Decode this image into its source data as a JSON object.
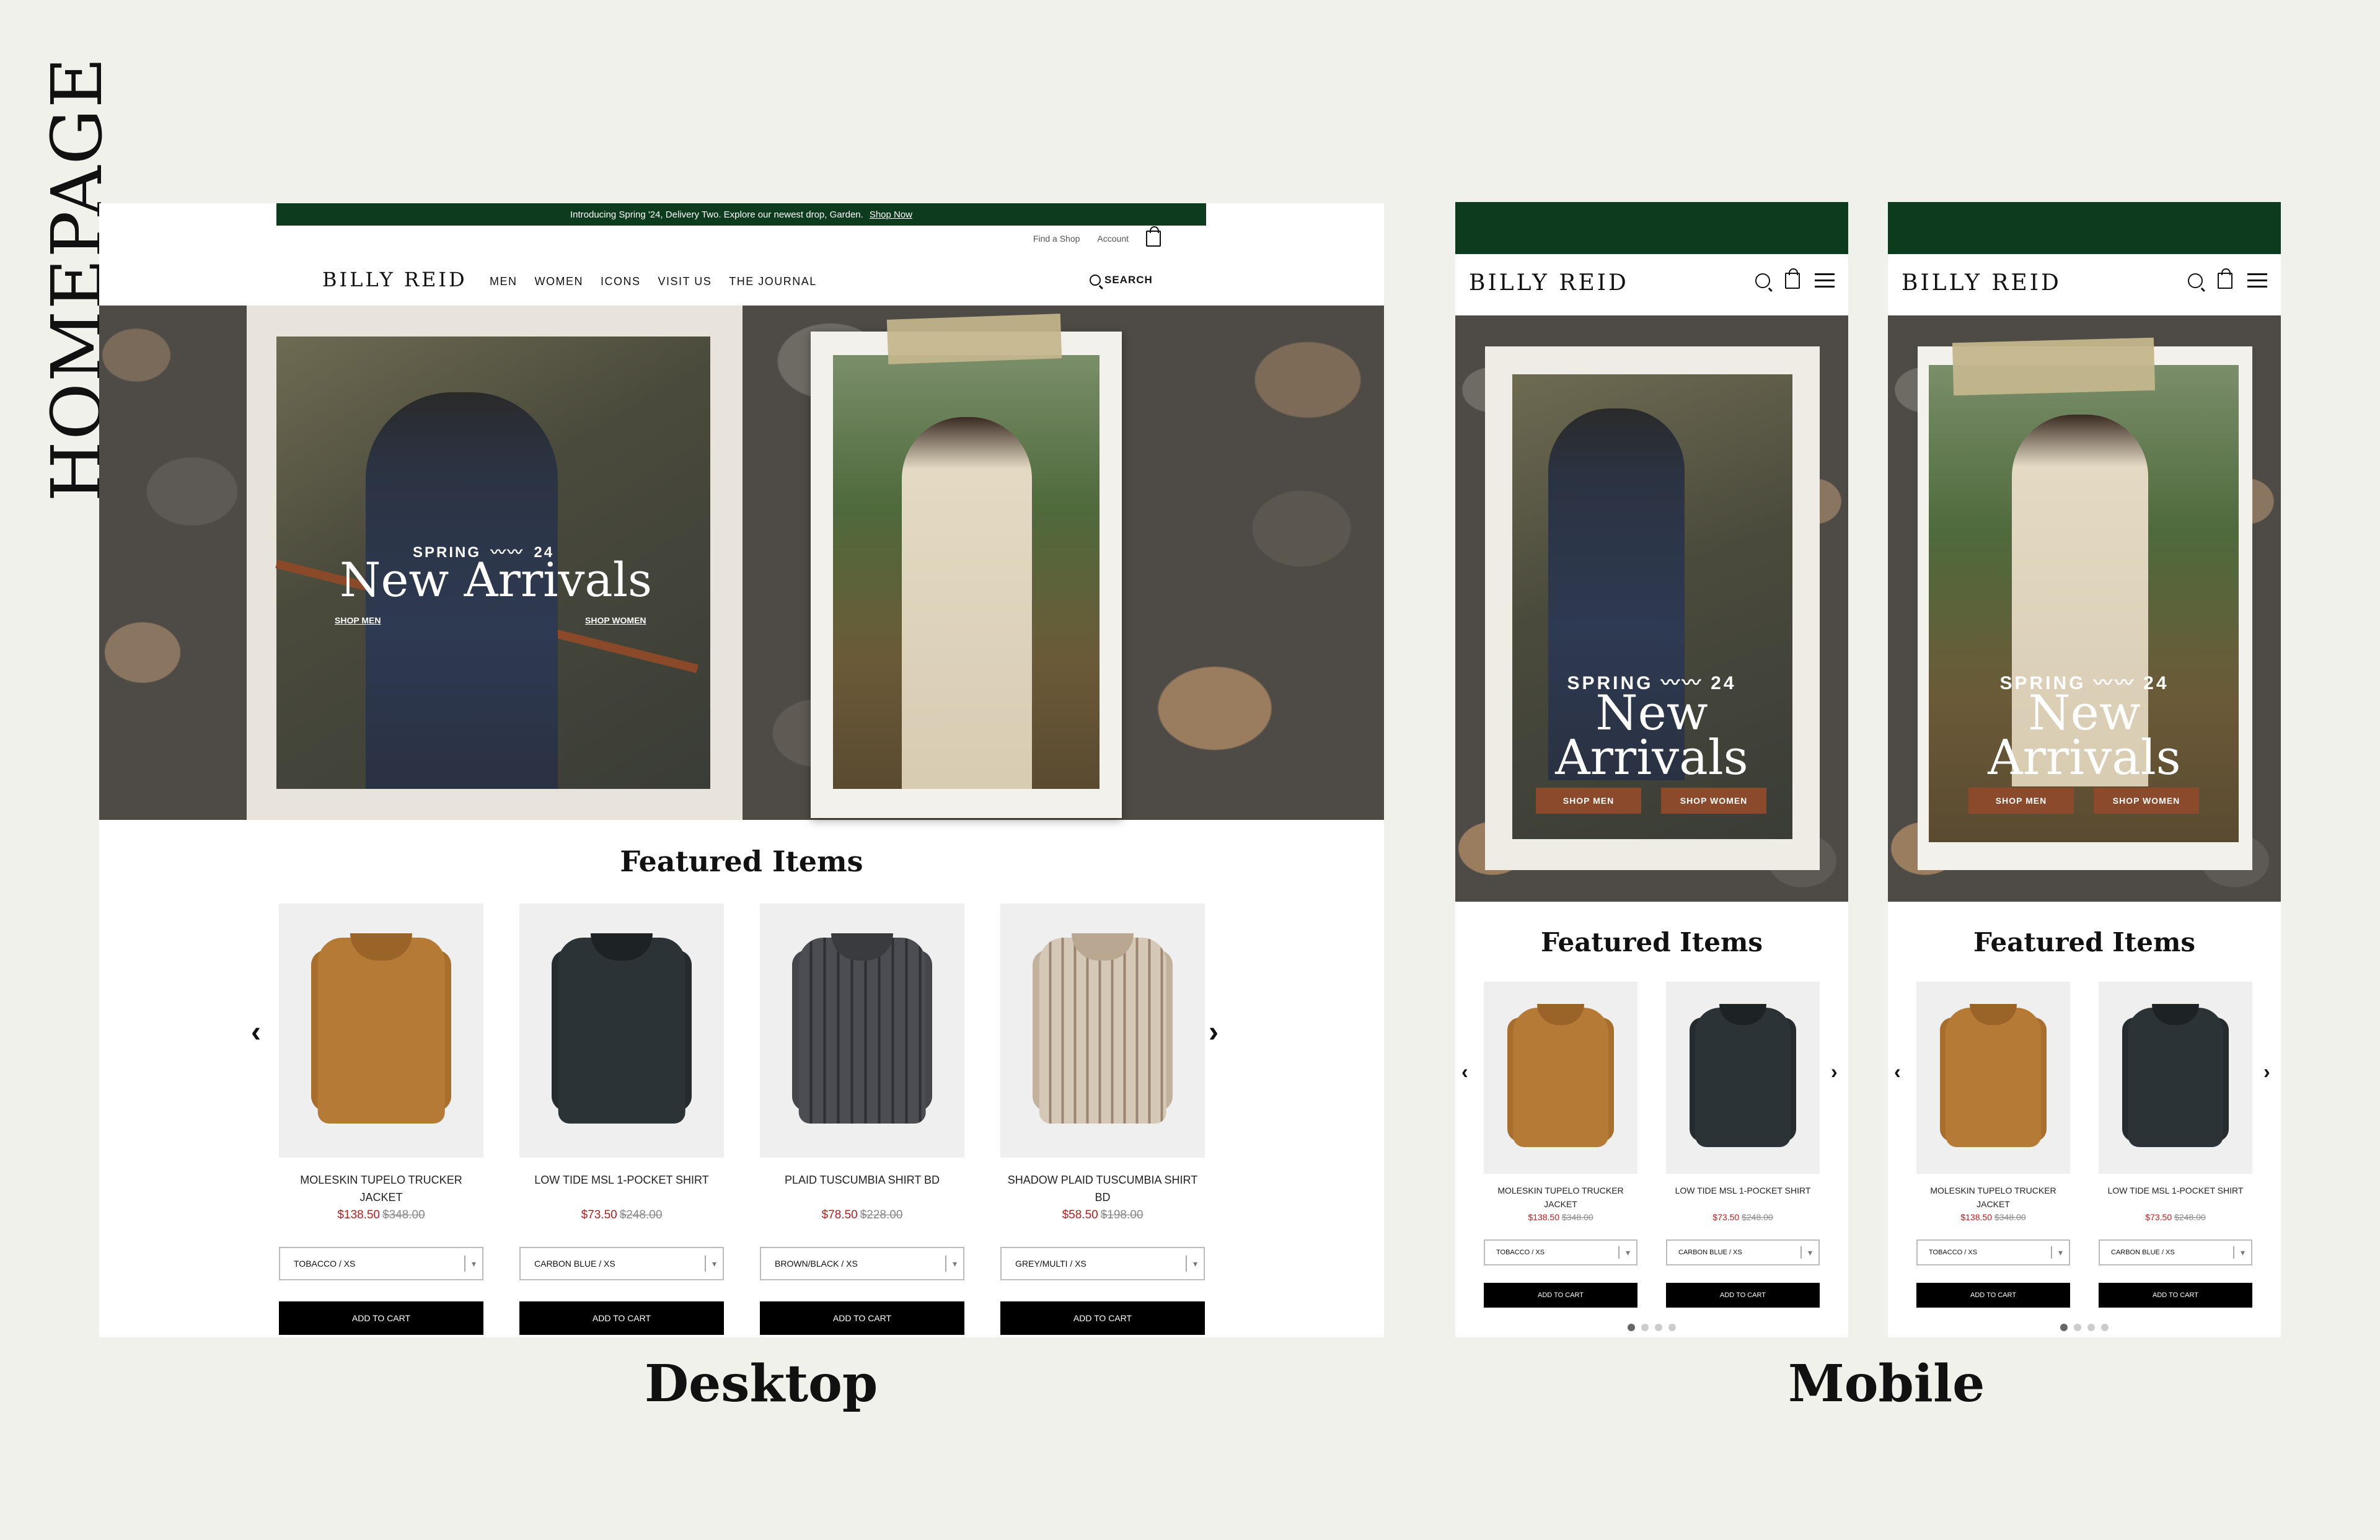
{
  "labels": {
    "homepage": "HOMEPAGE",
    "desktop": "Desktop",
    "mobile": "Mobile"
  },
  "brand": "BILLY REID",
  "announcement": {
    "text": "Introducing Spring '24, Delivery Two. Explore our newest drop, Garden.",
    "link": "Shop Now"
  },
  "utility": {
    "find_shop": "Find a Shop",
    "account": "Account"
  },
  "nav": [
    "MEN",
    "WOMEN",
    "ICONS",
    "VISIT US",
    "THE JOURNAL"
  ],
  "search_label": "SEARCH",
  "hero": {
    "spring": "SPRING",
    "year": "24",
    "title": "New Arrivals",
    "title_line1": "New",
    "title_line2": "Arrivals",
    "shop_men": "SHOP MEN",
    "shop_women": "SHOP WOMEN"
  },
  "featured_title": "Featured Items",
  "products": [
    {
      "name": "MOLESKIN TUPELO TRUCKER JACKET",
      "sale": "$138.50",
      "orig": "$348.00",
      "variant": "TOBACCO / XS",
      "atc": "ADD TO CART",
      "color": "#b57a35"
    },
    {
      "name": "LOW TIDE MSL 1-POCKET SHIRT",
      "sale": "$73.50",
      "orig": "$248.00",
      "variant": "CARBON BLUE / XS",
      "atc": "ADD TO CART",
      "color": "#2c3336"
    },
    {
      "name": "PLAID TUSCUMBIA SHIRT BD",
      "sale": "$78.50",
      "orig": "$228.00",
      "variant": "BROWN/BLACK / XS",
      "atc": "ADD TO CART",
      "color": "#4b4d52"
    },
    {
      "name": "SHADOW PLAID TUSCUMBIA SHIRT BD",
      "sale": "$58.50",
      "orig": "$198.00",
      "variant": "GREY/MULTI / XS",
      "atc": "ADD TO CART",
      "color": "#c9b9a6"
    }
  ],
  "colors": {
    "announce_bg": "#0d3b1d",
    "hero_button": "#8b4a2b",
    "sale_price": "#b21f1f"
  }
}
